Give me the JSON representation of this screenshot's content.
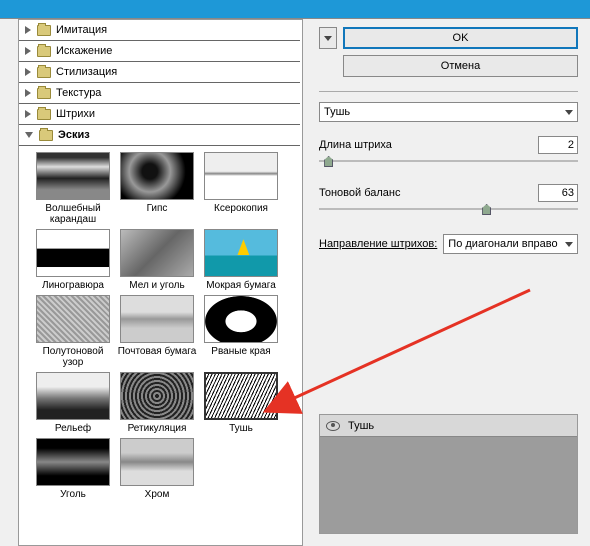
{
  "categories": [
    {
      "label": "Имитация",
      "expanded": false
    },
    {
      "label": "Искажение",
      "expanded": false
    },
    {
      "label": "Стилизация",
      "expanded": false
    },
    {
      "label": "Текстура",
      "expanded": false
    },
    {
      "label": "Штрихи",
      "expanded": false
    },
    {
      "label": "Эскиз",
      "expanded": true
    }
  ],
  "filters": [
    {
      "label": "Волшебный карандаш"
    },
    {
      "label": "Гипс"
    },
    {
      "label": "Ксерокопия"
    },
    {
      "label": "Линогравюра"
    },
    {
      "label": "Мел и уголь"
    },
    {
      "label": "Мокрая бумага"
    },
    {
      "label": "Полутоновой узор"
    },
    {
      "label": "Почтовая бумага"
    },
    {
      "label": "Рваные края"
    },
    {
      "label": "Рельеф"
    },
    {
      "label": "Ретикуляция"
    },
    {
      "label": "Тушь",
      "selected": true
    },
    {
      "label": "Уголь"
    },
    {
      "label": "Хром"
    }
  ],
  "buttons": {
    "ok": "OK",
    "cancel": "Отмена"
  },
  "filter_select": "Тушь",
  "params": {
    "stroke_length": {
      "label": "Длина штриха",
      "value": "2",
      "pos": 2
    },
    "tone_balance": {
      "label": "Тоновой баланс",
      "value": "63",
      "pos": 63
    }
  },
  "direction": {
    "label": "Направление штрихов:",
    "value": "По диагонали вправо"
  },
  "layer": {
    "name": "Тушь"
  }
}
